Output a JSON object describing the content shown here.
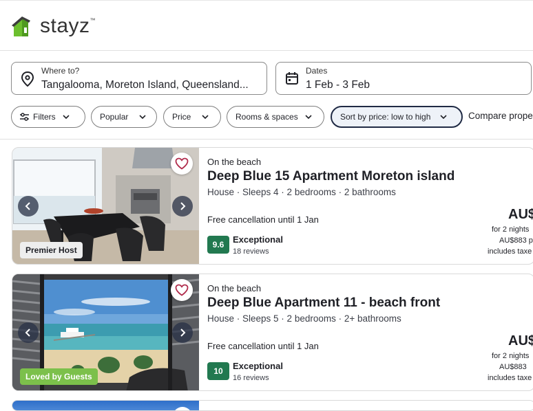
{
  "brand": {
    "name": "stayz",
    "tm": "™"
  },
  "search": {
    "where_label": "Where to?",
    "where_value": "Tangalooma, Moreton Island, Queensland...",
    "dates_label": "Dates",
    "dates_value": "1 Feb - 3 Feb"
  },
  "filters": [
    {
      "label": "Filters"
    },
    {
      "label": "Popular"
    },
    {
      "label": "Price"
    },
    {
      "label": "Rooms & spaces"
    },
    {
      "label": "Sort by price: low to high"
    }
  ],
  "compare_label": "Compare properties",
  "listings": [
    {
      "badge": "Premier Host",
      "tag": "On the beach",
      "title": "Deep Blue 15 Apartment Moreton island",
      "details": "House · Sleeps 4 · 2 bedrooms · 2 bathrooms",
      "cancellation": "Free cancellation until 1 Jan",
      "score": "9.6",
      "rating_word": "Exceptional",
      "reviews": "18 reviews",
      "price": "AU$",
      "price_note": "for 2 nights",
      "price_per": "AU$883 p",
      "price_taxes": "includes taxe"
    },
    {
      "badge": "Loved by Guests",
      "tag": "On the beach",
      "title": "Deep Blue Apartment 11 - beach front",
      "details": "House · Sleeps 5 · 2 bedrooms · 2+ bathrooms",
      "cancellation": "Free cancellation until 1 Jan",
      "score": "10",
      "rating_word": "Exceptional",
      "reviews": "16 reviews",
      "price": "AU$",
      "price_note": "for 2 nights",
      "price_per": "AU$883",
      "price_taxes": "includes taxe"
    }
  ],
  "colors": {
    "score_bg": "#227950",
    "loved_badge": "#7cc04b",
    "logo_green": "#6cbf2e",
    "heart": "#b02a4a"
  }
}
